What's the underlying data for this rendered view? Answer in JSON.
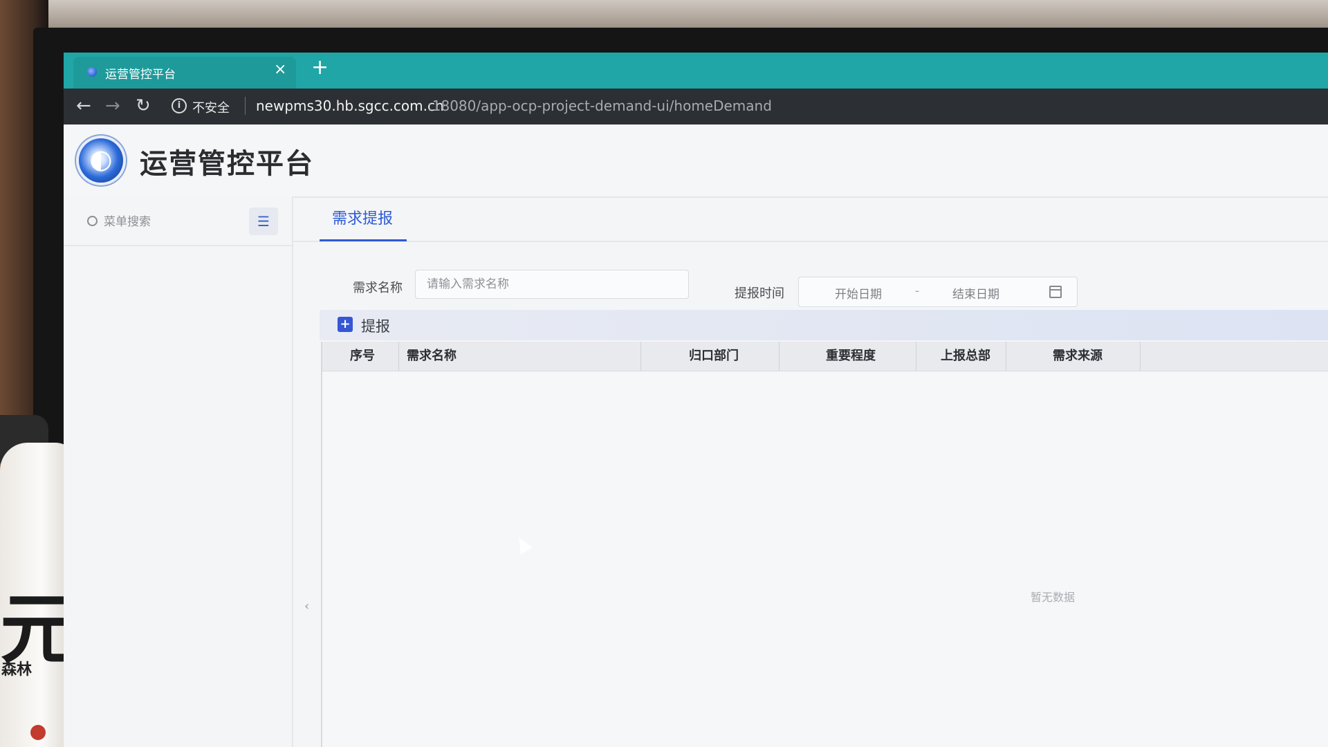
{
  "browser": {
    "tab_title": "运营管控平台",
    "tab_close": "×",
    "new_tab": "+",
    "nav": {
      "back": "←",
      "forward": "→",
      "reload": "↻"
    },
    "security_icon": "i",
    "security_text": "不安全",
    "url_host": "newpms30.hb.sgcc.com.cn",
    "url_path": ":18080/app-ocp-project-demand-ui/homeDemand"
  },
  "app": {
    "title": "运营管控平台",
    "logo_glyph": "◐"
  },
  "sidebar": {
    "search_placeholder": "菜单搜索",
    "toggle_icon": "☰",
    "collapse_icon": "‹"
  },
  "main": {
    "tab_label": "需求提报",
    "filters": {
      "name_label": "需求名称",
      "name_placeholder": "请输入需求名称",
      "time_label": "提报时间",
      "start_placeholder": "开始日期",
      "range_separator": "-",
      "end_placeholder": "结束日期"
    },
    "toolbar": {
      "add_icon": "+",
      "add_label": "提报"
    },
    "table": {
      "columns": [
        "序号",
        "需求名称",
        "归口部门",
        "重要程度",
        "上报总部",
        "需求来源"
      ],
      "empty_text": "暂无数据"
    }
  },
  "colors": {
    "tabbar": "#20a6a6",
    "addressbar": "#2c2f33",
    "accent": "#2d5bd7",
    "add_button": "#3557d6"
  }
}
